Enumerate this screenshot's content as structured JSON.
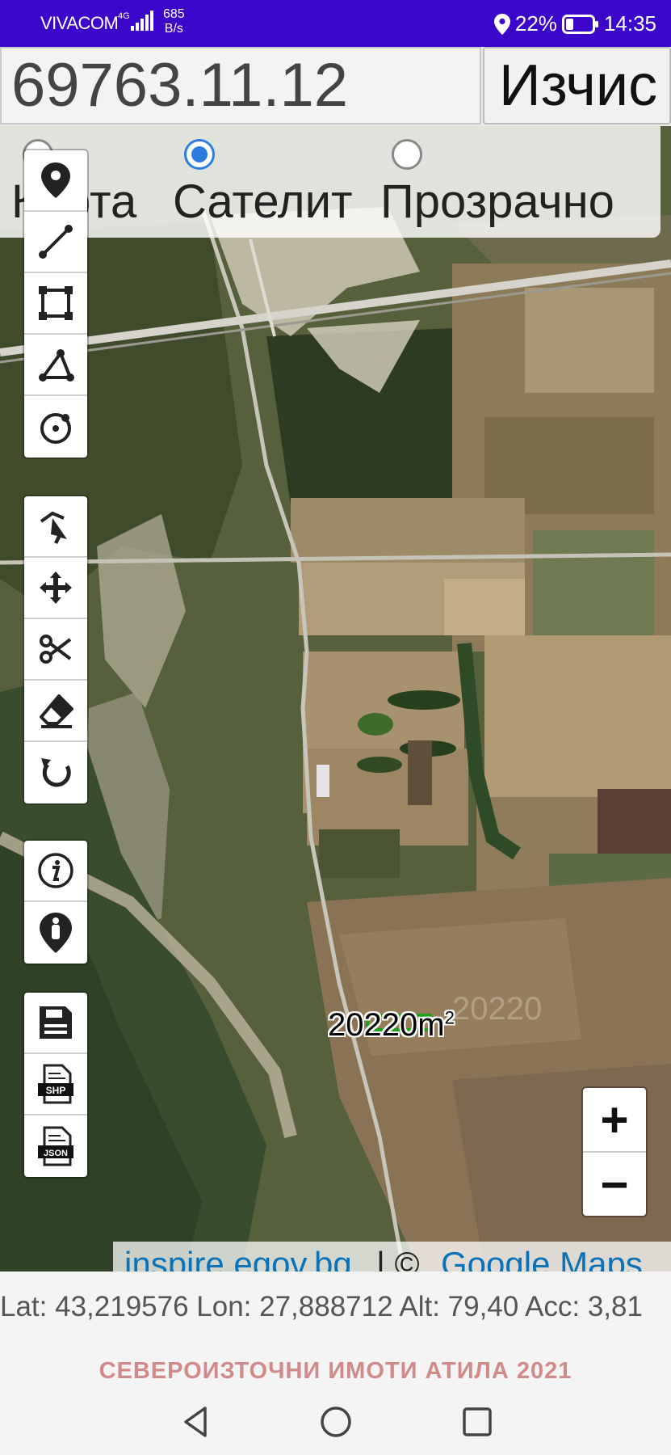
{
  "status_bar": {
    "carrier": "VIVACOM",
    "network": "4G⁺",
    "speed_value": "685",
    "speed_unit": "B/s",
    "battery": "22%",
    "time": "14:35",
    "icons": [
      "signal-icon",
      "location-icon",
      "battery-icon"
    ]
  },
  "search": {
    "parcel_value": "69763.11.12",
    "calc_button": "Изчис"
  },
  "map_type": {
    "options": [
      {
        "label": "Карта",
        "checked": false
      },
      {
        "label": "Сателит",
        "checked": true
      },
      {
        "label": "Прозрачно",
        "checked": false
      }
    ]
  },
  "toolbar": {
    "draw_tools": [
      "marker-icon",
      "line-icon",
      "rectangle-icon",
      "polygon-icon",
      "circle-icon"
    ],
    "edit_tools": [
      "select-icon",
      "move-icon",
      "cut-icon",
      "eraser-icon",
      "undo-icon"
    ],
    "info_tools": [
      "info-icon",
      "person-location-icon"
    ],
    "export_tools": [
      "save-icon",
      "shp-icon",
      "json-icon"
    ],
    "shp_label": "SHP",
    "json_label": "JSON"
  },
  "map": {
    "area_value": "20220",
    "area_unit": "m",
    "area_exp": "2",
    "ghost_value": "20220",
    "zoom_in": "+",
    "zoom_out": "−",
    "attribution_left": "inspire.egov.bg",
    "attribution_sep": " | © ",
    "attribution_right": "Google Maps"
  },
  "coords": {
    "text": "Lat: 43,219576 Lon: 27,888712 Alt: 79,40 Acc: 3,81"
  },
  "footer": {
    "title": "СЕВЕРОИЗТОЧНИ ИМОТИ АТИЛА 2021"
  },
  "colors": {
    "status_bar": "#3b06c9",
    "accent": "#2b7de0",
    "footer_title": "#d08a8a",
    "link": "#0a72b8"
  }
}
